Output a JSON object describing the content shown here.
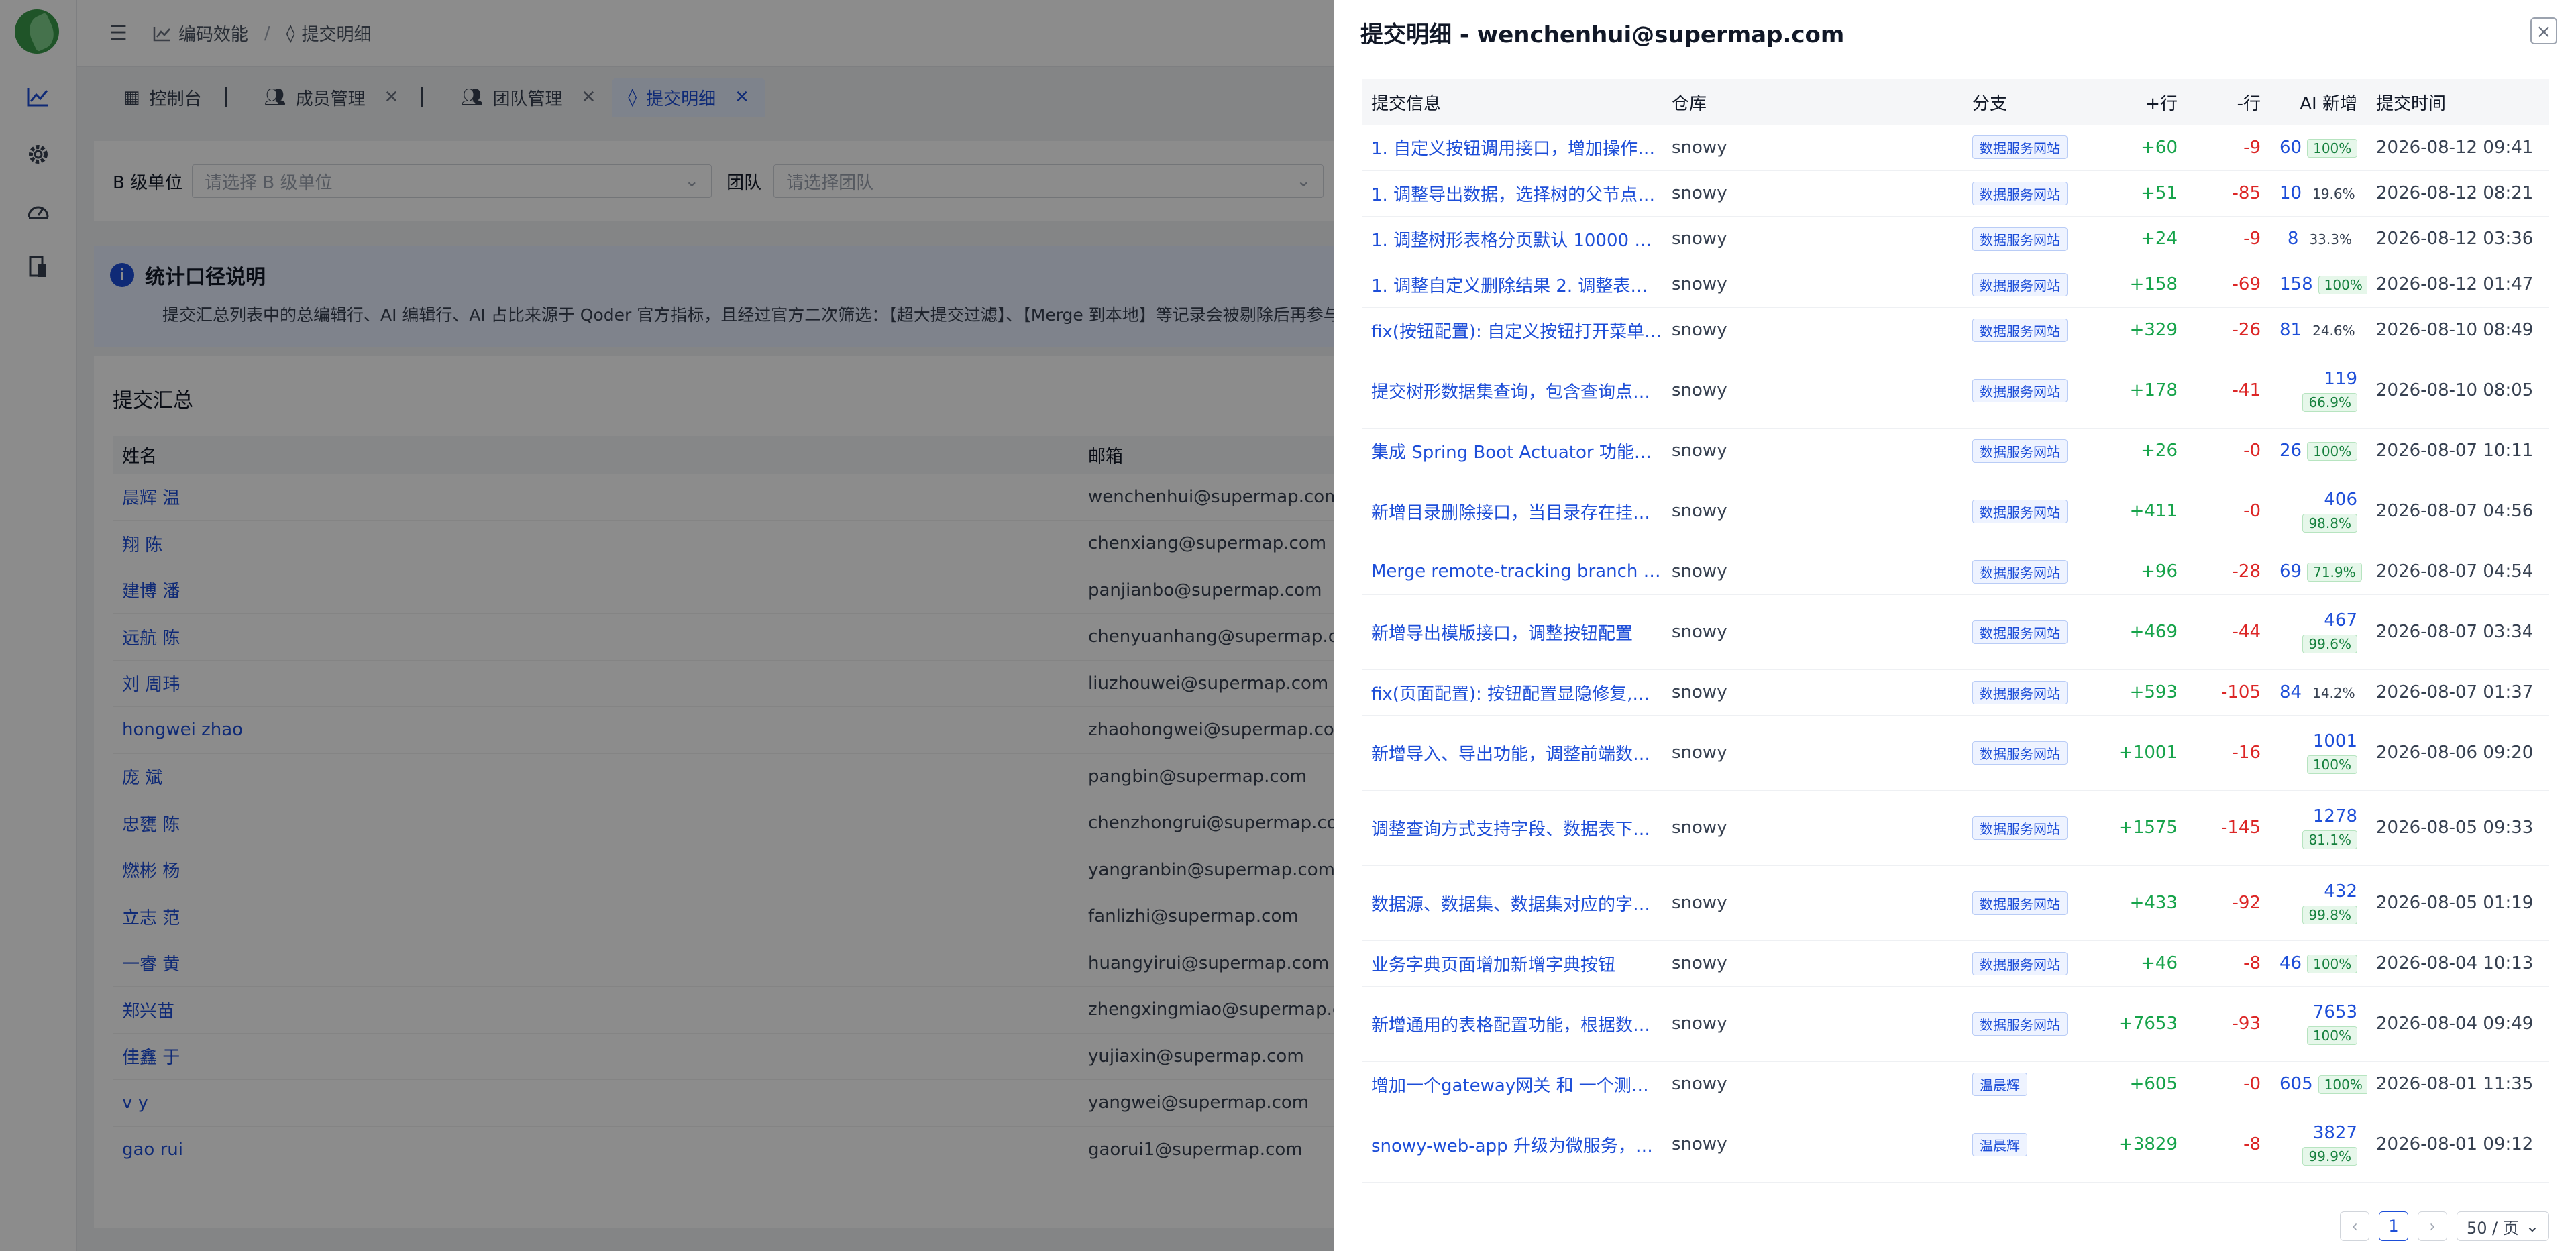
{
  "sidebar": {
    "icons": [
      "logo",
      "line-chart-icon",
      "gear-icon",
      "dashboard-icon",
      "document-icon"
    ]
  },
  "header": {
    "menu_icon": "menu-fold-icon",
    "crumb1": "编码效能",
    "crumb_sep": "/",
    "crumb2": "提交明细"
  },
  "tabs": [
    {
      "label": "控制台"
    },
    {
      "label": "成员管理"
    },
    {
      "label": "团队管理"
    },
    {
      "label": "提交明细"
    }
  ],
  "filters": {
    "unit_label": "B 级单位",
    "unit_placeholder": "请选择 B 级单位",
    "team_label": "团队",
    "team_placeholder": "请选择团队"
  },
  "notice": {
    "title": "统计口径说明",
    "text": "提交汇总列表中的总编辑行、AI 编辑行、AI 占比来源于 Qoder 官方指标，且经过官方二次筛选：【超大提交过滤】、【Merge 到本地】等记录会被剔除后再参与计算；"
  },
  "summary": {
    "title": "提交汇总",
    "col_name": "姓名",
    "col_email": "邮箱",
    "rows": [
      {
        "name": "晨辉 温",
        "email": "wenchenhui@supermap.com"
      },
      {
        "name": "翔 陈",
        "email": "chenxiang@supermap.com"
      },
      {
        "name": "建博 潘",
        "email": "panjianbo@supermap.com"
      },
      {
        "name": "远航 陈",
        "email": "chenyuanhang@supermap.com"
      },
      {
        "name": "刘 周玮",
        "email": "liuzhouwei@supermap.com"
      },
      {
        "name": "hongwei zhao",
        "email": "zhaohongwei@supermap.com"
      },
      {
        "name": "庞 斌",
        "email": "pangbin@supermap.com"
      },
      {
        "name": "忠甕 陈",
        "email": "chenzhongrui@supermap.com"
      },
      {
        "name": "燃彬 杨",
        "email": "yangranbin@supermap.com"
      },
      {
        "name": "立志 范",
        "email": "fanlizhi@supermap.com"
      },
      {
        "name": "一睿 黄",
        "email": "huangyirui@supermap.com"
      },
      {
        "name": "郑兴苗",
        "email": "zhengxingmiao@supermap.com"
      },
      {
        "name": "佳鑫 于",
        "email": "yujiaxin@supermap.com"
      },
      {
        "name": "v y",
        "email": "yangwei@supermap.com"
      },
      {
        "name": "gao rui",
        "email": "gaorui1@supermap.com"
      }
    ]
  },
  "drawer": {
    "title": "提交明细 - wenchenhui@supermap.com",
    "close_icon": "close-icon",
    "columns": {
      "msg": "提交信息",
      "repo": "仓库",
      "branch": "分支",
      "add": "+行",
      "del": "-行",
      "ai": "AI 新增",
      "time": "提交时间"
    },
    "rows": [
      {
        "msg": "1. 自定义按钮调用接口，增加操作提示…",
        "repo": "snowy",
        "branch": "数据服务网站",
        "add": "+60",
        "del": "-9",
        "ai": "60",
        "pct": "100%",
        "time": "2026-08-12 09:41"
      },
      {
        "msg": "1. 调整导出数据，选择树的父节点查询…",
        "repo": "snowy",
        "branch": "数据服务网站",
        "add": "+51",
        "del": "-85",
        "ai": "10",
        "pct": "19.6%",
        "time": "2026-08-12 08:21"
      },
      {
        "msg": "1. 调整树形表格分页默认 10000 条 2. 调…",
        "repo": "snowy",
        "branch": "数据服务网站",
        "add": "+24",
        "del": "-9",
        "ai": "8",
        "pct": "33.3%",
        "time": "2026-08-12 03:36"
      },
      {
        "msg": "1. 调整自定义删除结果 2. 调整表格内字…",
        "repo": "snowy",
        "branch": "数据服务网站",
        "add": "+158",
        "del": "-69",
        "ai": "158",
        "pct": "100%",
        "time": "2026-08-12 01:47"
      },
      {
        "msg": "fix(按钮配置): 自定义按钮打开菜单和ur…",
        "repo": "snowy",
        "branch": "数据服务网站",
        "add": "+329",
        "del": "-26",
        "ai": "81",
        "pct": "24.6%",
        "time": "2026-08-10 08:49"
      },
      {
        "msg": "提交树形数据集查询，包含查询点击树…",
        "repo": "snowy",
        "branch": "数据服务网站",
        "add": "+178",
        "del": "-41",
        "ai": "119",
        "pct": "66.9%",
        "time": "2026-08-10 08:05"
      },
      {
        "msg": "集成 Spring Boot Actuator 功能，可以…",
        "repo": "snowy",
        "branch": "数据服务网站",
        "add": "+26",
        "del": "-0",
        "ai": "26",
        "pct": "100%",
        "time": "2026-08-07 10:11"
      },
      {
        "msg": "新增目录删除接口，当目录存在挂接的…",
        "repo": "snowy",
        "branch": "数据服务网站",
        "add": "+411",
        "del": "-0",
        "ai": "406",
        "pct": "98.8%",
        "time": "2026-08-07 04:56"
      },
      {
        "msg": "Merge remote-tracking branch 'origin…",
        "repo": "snowy",
        "branch": "数据服务网站",
        "add": "+96",
        "del": "-28",
        "ai": "69",
        "pct": "71.9%",
        "time": "2026-08-07 04:54"
      },
      {
        "msg": "新增导出模版接口，调整按钮配置",
        "repo": "snowy",
        "branch": "数据服务网站",
        "add": "+469",
        "del": "-44",
        "ai": "467",
        "pct": "99.6%",
        "time": "2026-08-07 03:34"
      },
      {
        "msg": "fix(页面配置): 按钮配置显隐修复,自定…",
        "repo": "snowy",
        "branch": "数据服务网站",
        "add": "+593",
        "del": "-105",
        "ai": "84",
        "pct": "14.2%",
        "time": "2026-08-07 01:37"
      },
      {
        "msg": "新增导入、导出功能，调整前端数据模…",
        "repo": "snowy",
        "branch": "数据服务网站",
        "add": "+1001",
        "del": "-16",
        "ai": "1001",
        "pct": "100%",
        "time": "2026-08-06 09:20"
      },
      {
        "msg": "调整查询方式支持字段、数据表下拉框",
        "repo": "snowy",
        "branch": "数据服务网站",
        "add": "+1575",
        "del": "-145",
        "ai": "1278",
        "pct": "81.1%",
        "time": "2026-08-05 09:33"
      },
      {
        "msg": "数据源、数据集、数据集对应的字段结…",
        "repo": "snowy",
        "branch": "数据服务网站",
        "add": "+433",
        "del": "-92",
        "ai": "432",
        "pct": "99.8%",
        "time": "2026-08-05 01:19"
      },
      {
        "msg": "业务字典页面增加新增字典按钮",
        "repo": "snowy",
        "branch": "数据服务网站",
        "add": "+46",
        "del": "-8",
        "ai": "46",
        "pct": "100%",
        "time": "2026-08-04 10:13"
      },
      {
        "msg": "新增通用的表格配置功能，根据数据库…",
        "repo": "snowy",
        "branch": "数据服务网站",
        "add": "+7653",
        "del": "-93",
        "ai": "7653",
        "pct": "100%",
        "time": "2026-08-04 09:49"
      },
      {
        "msg": "增加一个gateway网关 和 一个测试的…",
        "repo": "snowy",
        "branch": "温晨辉",
        "add": "+605",
        "del": "-0",
        "ai": "605",
        "pct": "100%",
        "time": "2026-08-01 11:35"
      },
      {
        "msg": "snowy-web-app 升级为微服务，使用n…",
        "repo": "snowy",
        "branch": "温晨辉",
        "add": "+3829",
        "del": "-8",
        "ai": "3827",
        "pct": "99.9%",
        "time": "2026-08-01 09:12"
      }
    ]
  },
  "pager": {
    "prev_icon": "chevron-left-icon",
    "page": "1",
    "next_icon": "chevron-right-icon",
    "size": "50 / 页",
    "size_icon": "chevron-down-icon"
  }
}
